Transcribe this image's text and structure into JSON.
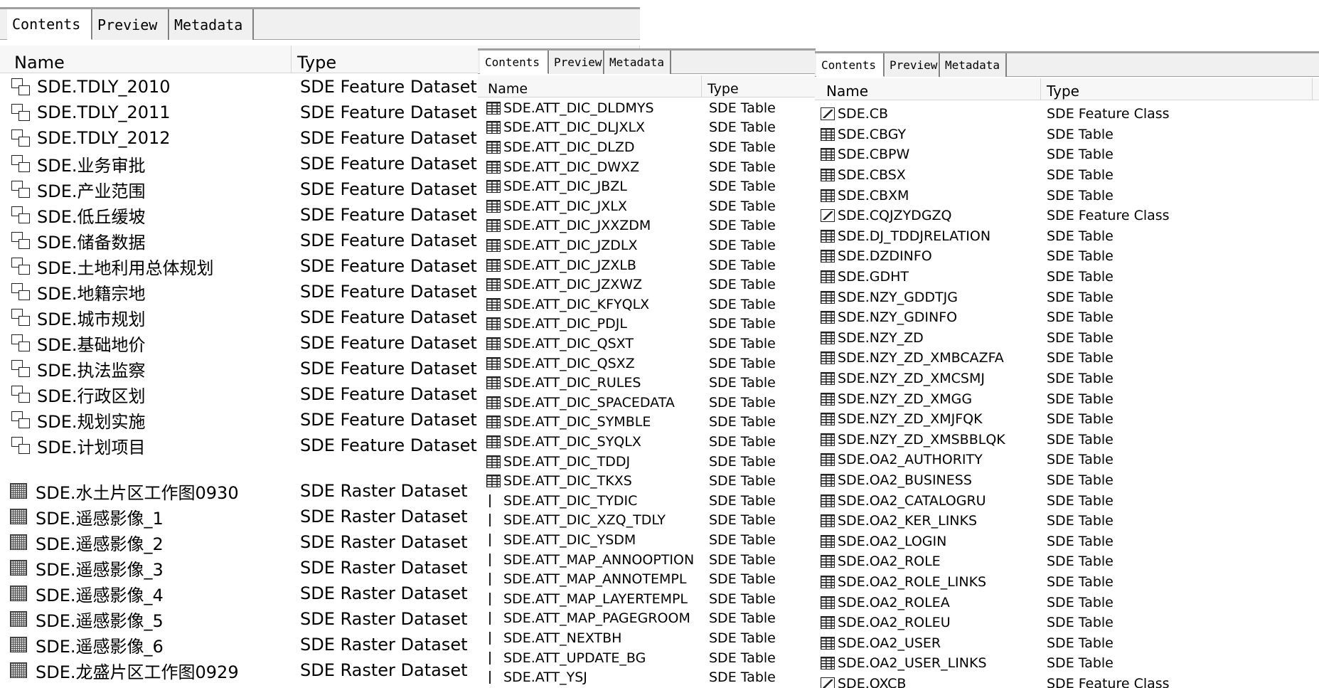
{
  "panels": [
    {
      "tabs": [
        "Contents",
        "Preview",
        "Metadata"
      ],
      "active_tab": "Contents",
      "columns": [
        "Name",
        "Type"
      ],
      "rows": [
        {
          "name": "SDE.TDLY_2010",
          "type": "SDE Feature Dataset",
          "icon": "feature-dataset-icon"
        },
        {
          "name": "SDE.TDLY_2011",
          "type": "SDE Feature Dataset",
          "icon": "feature-dataset-icon"
        },
        {
          "name": "SDE.TDLY_2012",
          "type": "SDE Feature Dataset",
          "icon": "feature-dataset-icon"
        },
        {
          "name": "SDE.业务审批",
          "type": "SDE Feature Dataset",
          "icon": "feature-dataset-icon"
        },
        {
          "name": "SDE.产业范围",
          "type": "SDE Feature Dataset",
          "icon": "feature-dataset-icon"
        },
        {
          "name": "SDE.低丘缓坡",
          "type": "SDE Feature Dataset",
          "icon": "feature-dataset-icon"
        },
        {
          "name": "SDE.储备数据",
          "type": "SDE Feature Dataset",
          "icon": "feature-dataset-icon"
        },
        {
          "name": "SDE.土地利用总体规划",
          "type": "SDE Feature Dataset",
          "icon": "feature-dataset-icon"
        },
        {
          "name": "SDE.地籍宗地",
          "type": "SDE Feature Dataset",
          "icon": "feature-dataset-icon"
        },
        {
          "name": "SDE.城市规划",
          "type": "SDE Feature Dataset",
          "icon": "feature-dataset-icon"
        },
        {
          "name": "SDE.基础地价",
          "type": "SDE Feature Dataset",
          "icon": "feature-dataset-icon"
        },
        {
          "name": "SDE.执法监察",
          "type": "SDE Feature Dataset",
          "icon": "feature-dataset-icon"
        },
        {
          "name": "SDE.行政区划",
          "type": "SDE Feature Dataset",
          "icon": "feature-dataset-icon"
        },
        {
          "name": "SDE.规划实施",
          "type": "SDE Feature Dataset",
          "icon": "feature-dataset-icon"
        },
        {
          "name": "SDE.计划项目",
          "type": "SDE Feature Dataset",
          "icon": "feature-dataset-icon"
        }
      ]
    },
    {
      "rows": [
        {
          "name": "SDE.水土片区工作图0930",
          "type": "SDE Raster Dataset",
          "icon": "raster-dataset-icon"
        },
        {
          "name": "SDE.遥感影像_1",
          "type": "SDE Raster Dataset",
          "icon": "raster-dataset-icon"
        },
        {
          "name": "SDE.遥感影像_2",
          "type": "SDE Raster Dataset",
          "icon": "raster-dataset-icon"
        },
        {
          "name": "SDE.遥感影像_3",
          "type": "SDE Raster Dataset",
          "icon": "raster-dataset-icon"
        },
        {
          "name": "SDE.遥感影像_4",
          "type": "SDE Raster Dataset",
          "icon": "raster-dataset-icon"
        },
        {
          "name": "SDE.遥感影像_5",
          "type": "SDE Raster Dataset",
          "icon": "raster-dataset-icon"
        },
        {
          "name": "SDE.遥感影像_6",
          "type": "SDE Raster Dataset",
          "icon": "raster-dataset-icon"
        },
        {
          "name": "SDE.龙盛片区工作图0929",
          "type": "SDE Raster Dataset",
          "icon": "raster-dataset-icon"
        }
      ]
    },
    {
      "tabs": [
        "Contents",
        "Preview",
        "Metadata"
      ],
      "active_tab": "Contents",
      "columns": [
        "Name",
        "Type"
      ],
      "rows": [
        {
          "name": "SDE.ATT_DIC_DLDMYS",
          "type": "SDE Table",
          "icon": "table-icon"
        },
        {
          "name": "SDE.ATT_DIC_DLJXLX",
          "type": "SDE Table",
          "icon": "table-icon"
        },
        {
          "name": "SDE.ATT_DIC_DLZD",
          "type": "SDE Table",
          "icon": "table-icon"
        },
        {
          "name": "SDE.ATT_DIC_DWXZ",
          "type": "SDE Table",
          "icon": "table-icon"
        },
        {
          "name": "SDE.ATT_DIC_JBZL",
          "type": "SDE Table",
          "icon": "table-icon"
        },
        {
          "name": "SDE.ATT_DIC_JXLX",
          "type": "SDE Table",
          "icon": "table-icon"
        },
        {
          "name": "SDE.ATT_DIC_JXXZDM",
          "type": "SDE Table",
          "icon": "table-icon"
        },
        {
          "name": "SDE.ATT_DIC_JZDLX",
          "type": "SDE Table",
          "icon": "table-icon"
        },
        {
          "name": "SDE.ATT_DIC_JZXLB",
          "type": "SDE Table",
          "icon": "table-icon"
        },
        {
          "name": "SDE.ATT_DIC_JZXWZ",
          "type": "SDE Table",
          "icon": "table-icon"
        },
        {
          "name": "SDE.ATT_DIC_KFYQLX",
          "type": "SDE Table",
          "icon": "table-icon"
        },
        {
          "name": "SDE.ATT_DIC_PDJL",
          "type": "SDE Table",
          "icon": "table-icon"
        },
        {
          "name": "SDE.ATT_DIC_QSXT",
          "type": "SDE Table",
          "icon": "table-icon"
        },
        {
          "name": "SDE.ATT_DIC_QSXZ",
          "type": "SDE Table",
          "icon": "table-icon"
        },
        {
          "name": "SDE.ATT_DIC_RULES",
          "type": "SDE Table",
          "icon": "table-icon"
        },
        {
          "name": "SDE.ATT_DIC_SPACEDATA",
          "type": "SDE Table",
          "icon": "table-icon"
        },
        {
          "name": "SDE.ATT_DIC_SYMBLE",
          "type": "SDE Table",
          "icon": "table-icon"
        },
        {
          "name": "SDE.ATT_DIC_SYQLX",
          "type": "SDE Table",
          "icon": "table-icon"
        },
        {
          "name": "SDE.ATT_DIC_TDDJ",
          "type": "SDE Table",
          "icon": "table-icon"
        },
        {
          "name": "SDE.ATT_DIC_TKXS",
          "type": "SDE Table",
          "icon": "table-icon"
        },
        {
          "name": "SDE.ATT_DIC_TYDIC",
          "type": "SDE Table",
          "icon": "table-icon"
        },
        {
          "name": "SDE.ATT_DIC_XZQ_TDLY",
          "type": "SDE Table",
          "icon": "table-icon"
        },
        {
          "name": "SDE.ATT_DIC_YSDM",
          "type": "SDE Table",
          "icon": "table-icon"
        },
        {
          "name": "SDE.ATT_MAP_ANNOOPTION",
          "type": "SDE Table",
          "icon": "table-icon"
        },
        {
          "name": "SDE.ATT_MAP_ANNOTEMPL",
          "type": "SDE Table",
          "icon": "table-icon"
        },
        {
          "name": "SDE.ATT_MAP_LAYERTEMPL",
          "type": "SDE Table",
          "icon": "table-icon"
        },
        {
          "name": "SDE.ATT_MAP_PAGEGROOM",
          "type": "SDE Table",
          "icon": "table-icon"
        },
        {
          "name": "SDE.ATT_NEXTBH",
          "type": "SDE Table",
          "icon": "table-icon"
        },
        {
          "name": "SDE.ATT_UPDATE_BG",
          "type": "SDE Table",
          "icon": "table-icon"
        },
        {
          "name": "SDE.ATT_YSJ",
          "type": "SDE Table",
          "icon": "table-icon"
        }
      ]
    },
    {
      "tabs": [
        "Contents",
        "Preview",
        "Metadata"
      ],
      "active_tab": "Contents",
      "columns": [
        "Name",
        "Type"
      ],
      "rows": [
        {
          "name": "SDE.CB",
          "type": "SDE Feature Class",
          "icon": "feature-class-icon"
        },
        {
          "name": "SDE.CBGY",
          "type": "SDE Table",
          "icon": "table-icon"
        },
        {
          "name": "SDE.CBPW",
          "type": "SDE Table",
          "icon": "table-icon"
        },
        {
          "name": "SDE.CBSX",
          "type": "SDE Table",
          "icon": "table-icon"
        },
        {
          "name": "SDE.CBXM",
          "type": "SDE Table",
          "icon": "table-icon"
        },
        {
          "name": "SDE.CQJZYDGZQ",
          "type": "SDE Feature Class",
          "icon": "feature-class-icon"
        },
        {
          "name": "SDE.DJ_TDDJRELATION",
          "type": "SDE Table",
          "icon": "table-icon"
        },
        {
          "name": "SDE.DZDINFO",
          "type": "SDE Table",
          "icon": "table-icon"
        },
        {
          "name": "SDE.GDHT",
          "type": "SDE Table",
          "icon": "table-icon"
        },
        {
          "name": "SDE.NZY_GDDTJG",
          "type": "SDE Table",
          "icon": "table-icon"
        },
        {
          "name": "SDE.NZY_GDINFO",
          "type": "SDE Table",
          "icon": "table-icon"
        },
        {
          "name": "SDE.NZY_ZD",
          "type": "SDE Table",
          "icon": "table-icon"
        },
        {
          "name": "SDE.NZY_ZD_XMBCAZFA",
          "type": "SDE Table",
          "icon": "table-icon"
        },
        {
          "name": "SDE.NZY_ZD_XMCSMJ",
          "type": "SDE Table",
          "icon": "table-icon"
        },
        {
          "name": "SDE.NZY_ZD_XMGG",
          "type": "SDE Table",
          "icon": "table-icon"
        },
        {
          "name": "SDE.NZY_ZD_XMJFQK",
          "type": "SDE Table",
          "icon": "table-icon"
        },
        {
          "name": "SDE.NZY_ZD_XMSBBLQK",
          "type": "SDE Table",
          "icon": "table-icon"
        },
        {
          "name": "SDE.OA2_AUTHORITY",
          "type": "SDE Table",
          "icon": "table-icon"
        },
        {
          "name": "SDE.OA2_BUSINESS",
          "type": "SDE Table",
          "icon": "table-icon"
        },
        {
          "name": "SDE.OA2_CATALOGRU",
          "type": "SDE Table",
          "icon": "table-icon"
        },
        {
          "name": "SDE.OA2_KER_LINKS",
          "type": "SDE Table",
          "icon": "table-icon"
        },
        {
          "name": "SDE.OA2_LOGIN",
          "type": "SDE Table",
          "icon": "table-icon"
        },
        {
          "name": "SDE.OA2_ROLE",
          "type": "SDE Table",
          "icon": "table-icon"
        },
        {
          "name": "SDE.OA2_ROLE_LINKS",
          "type": "SDE Table",
          "icon": "table-icon"
        },
        {
          "name": "SDE.OA2_ROLEA",
          "type": "SDE Table",
          "icon": "table-icon"
        },
        {
          "name": "SDE.OA2_ROLEU",
          "type": "SDE Table",
          "icon": "table-icon"
        },
        {
          "name": "SDE.OA2_USER",
          "type": "SDE Table",
          "icon": "table-icon"
        },
        {
          "name": "SDE.OA2_USER_LINKS",
          "type": "SDE Table",
          "icon": "table-icon"
        },
        {
          "name": "SDE.OXCB",
          "type": "SDE Feature Class",
          "icon": "feature-class-icon"
        }
      ]
    }
  ]
}
